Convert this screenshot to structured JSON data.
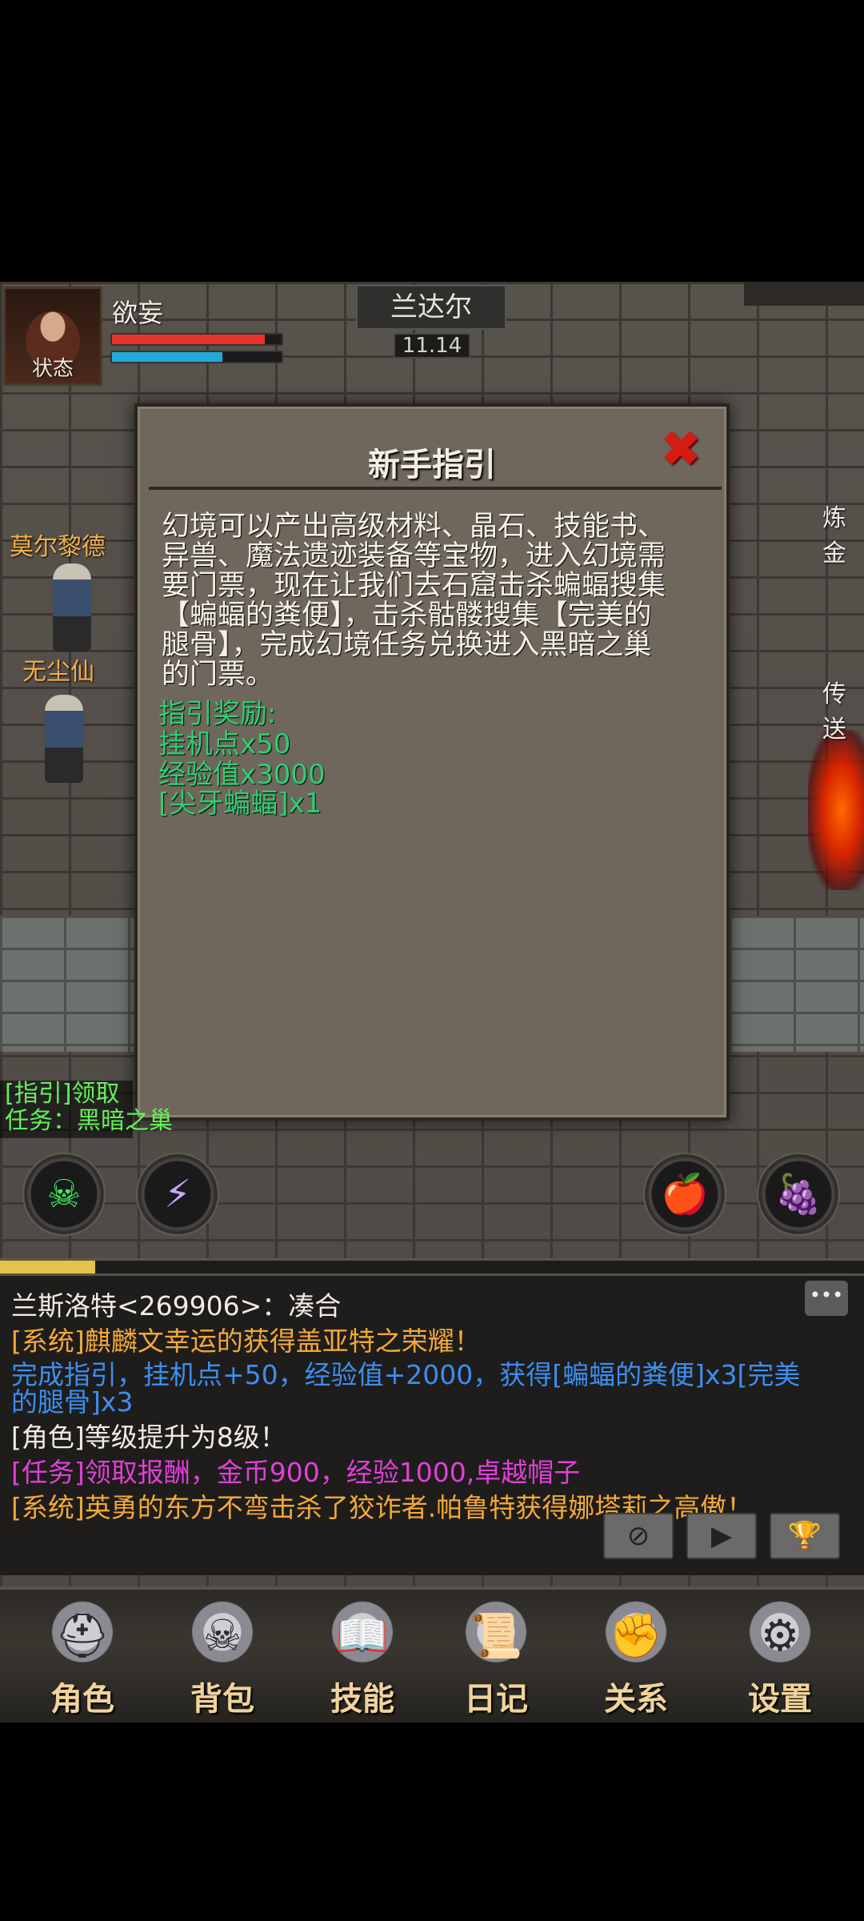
{
  "player": {
    "status_label": "状态",
    "name": "欲妄",
    "hp_fraction": 0.9,
    "mp_fraction": 0.65,
    "hp_color": "#e8322c",
    "mp_color": "#22a9d8"
  },
  "map": {
    "name": "兰达尔",
    "coords": "11.14"
  },
  "npcs": [
    "莫尔黎德",
    "无尘仙"
  ],
  "right_labels": [
    "炼金",
    "传送"
  ],
  "dialog": {
    "title": "新手指引",
    "close_icon": "close-x-icon",
    "body_lines": [
      "幻境可以产出高级材料、晶石、技能书、",
      "异兽、魔法遗迹装备等宝物，进入幻境需",
      "要门票，现在让我们去石窟击杀蝙蝠搜集",
      "【蝙蝠的粪便】，击杀骷髅搜集【完美的",
      "腿骨】，完成幻境任务兑换进入黑暗之巢",
      "的门票。"
    ],
    "reward_title": "指引奖励:",
    "rewards": [
      "挂机点x50",
      "经验值x3000",
      "[尖牙蝙蝠]x1"
    ]
  },
  "quest": {
    "line1": "[指引]领取",
    "line2": "任务：黑暗之巢"
  },
  "skills": [
    {
      "icon": "toxic-skull-icon",
      "glyph": "☠",
      "color": "#3cf060"
    },
    {
      "icon": "lightning-orb-icon",
      "glyph": "⚡",
      "color": "#c9a6ff"
    },
    {
      "icon": "apple-icon",
      "glyph": "🍎",
      "color": "#e02020"
    },
    {
      "icon": "grapes-icon",
      "glyph": "🍇",
      "color": "#9b4fd0"
    }
  ],
  "exp_fraction": 0.11,
  "chat": {
    "header": "兰斯洛特<269906>：凑合",
    "lines": [
      {
        "text": "[系统]麒麟文幸运的获得盖亚特之荣耀！",
        "color": "#f3a838"
      },
      {
        "text": "完成指引，挂机点+50，经验值+2000，获得[蝙蝠的粪便]x3[完美",
        "color": "#3c8ef0"
      },
      {
        "text": "的腿骨]x3",
        "color": "#3c8ef0"
      },
      {
        "text": "[角色]等级提升为8级！",
        "color": "#f0ece4"
      },
      {
        "text": "[任务]领取报酬，金币900，经验1000,卓越帽子",
        "color": "#e040d8"
      },
      {
        "text": "[系统]英勇的东方不弯击杀了狡诈者.帕鲁特获得娜塔莉之高傲！",
        "color": "#f3a838"
      }
    ],
    "bubble_icon": "chat-bubble-icon",
    "controls": [
      {
        "icon": "compass-icon",
        "glyph": "⊘"
      },
      {
        "icon": "play-icon",
        "glyph": "▶"
      },
      {
        "icon": "trophy-icon",
        "glyph": "🏆"
      }
    ]
  },
  "nav": [
    {
      "label": "角色",
      "icon": "helmet-icon",
      "glyph": "⛑"
    },
    {
      "label": "背包",
      "icon": "backpack-icon",
      "glyph": "☠"
    },
    {
      "label": "技能",
      "icon": "spellbook-icon",
      "glyph": "📖"
    },
    {
      "label": "日记",
      "icon": "scroll-icon",
      "glyph": "📜"
    },
    {
      "label": "关系",
      "icon": "gauntlets-icon",
      "glyph": "✊"
    },
    {
      "label": "设置",
      "icon": "gears-icon",
      "glyph": "⚙"
    }
  ]
}
